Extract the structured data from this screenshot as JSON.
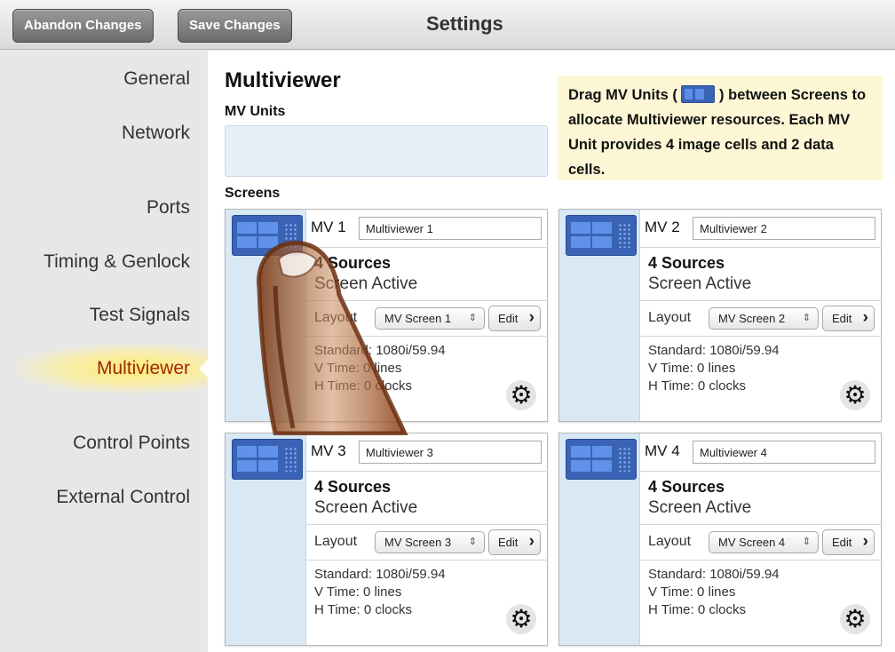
{
  "toolbar": {
    "abandon_label": "Abandon Changes",
    "save_label": "Save Changes",
    "title": "Settings"
  },
  "sidebar": {
    "items": [
      {
        "label": "General"
      },
      {
        "label": "Network"
      },
      {
        "label": "Ports"
      },
      {
        "label": "Timing & Genlock"
      },
      {
        "label": "Test Signals"
      },
      {
        "label": "Multiviewer",
        "active": true
      },
      {
        "label": "Control Points"
      },
      {
        "label": "External Control"
      }
    ]
  },
  "main": {
    "title": "Multiviewer",
    "mv_units_label": "MV Units",
    "screens_label": "Screens",
    "help": {
      "part1": "Drag MV Units (",
      "part2": ") between Screens to allocate Multiviewer resources. Each MV Unit provides 4 image cells and 2 data cells."
    },
    "screens": [
      {
        "id": "MV 1",
        "name": "Multiviewer 1",
        "sources": "4 Sources",
        "status": "Screen Active",
        "layout_label": "Layout",
        "layout_value": "MV Screen 1",
        "edit_label": "Edit",
        "standard": "Standard: 1080i/59.94",
        "vtime": "V Time: 0 lines",
        "htime": "H Time: 0 clocks"
      },
      {
        "id": "MV 2",
        "name": "Multiviewer 2",
        "sources": "4 Sources",
        "status": "Screen Active",
        "layout_label": "Layout",
        "layout_value": "MV Screen 2",
        "edit_label": "Edit",
        "standard": "Standard: 1080i/59.94",
        "vtime": "V Time: 0 lines",
        "htime": "H Time: 0 clocks"
      },
      {
        "id": "MV 3",
        "name": "Multiviewer 3",
        "sources": "4 Sources",
        "status": "Screen Active",
        "layout_label": "Layout",
        "layout_value": "MV Screen 3",
        "edit_label": "Edit",
        "standard": "Standard: 1080i/59.94",
        "vtime": "V Time: 0 lines",
        "htime": "H Time: 0 clocks"
      },
      {
        "id": "MV 4",
        "name": "Multiviewer 4",
        "sources": "4 Sources",
        "status": "Screen Active",
        "layout_label": "Layout",
        "layout_value": "MV Screen 4",
        "edit_label": "Edit",
        "standard": "Standard: 1080i/59.94",
        "vtime": "V Time: 0 lines",
        "htime": "H Time: 0 clocks"
      }
    ]
  },
  "colors": {
    "mv_unit_blue": "#3b63b5",
    "active_nav_text": "#a0280c",
    "help_background": "#fdf7d6"
  },
  "icons": {
    "mv_unit": "mv-unit-icon",
    "settings": "gear-icon",
    "edit_chevron": "chevron-right-icon",
    "select_arrows": "select-arrows-icon",
    "overlay": "finger-pointer-icon"
  }
}
